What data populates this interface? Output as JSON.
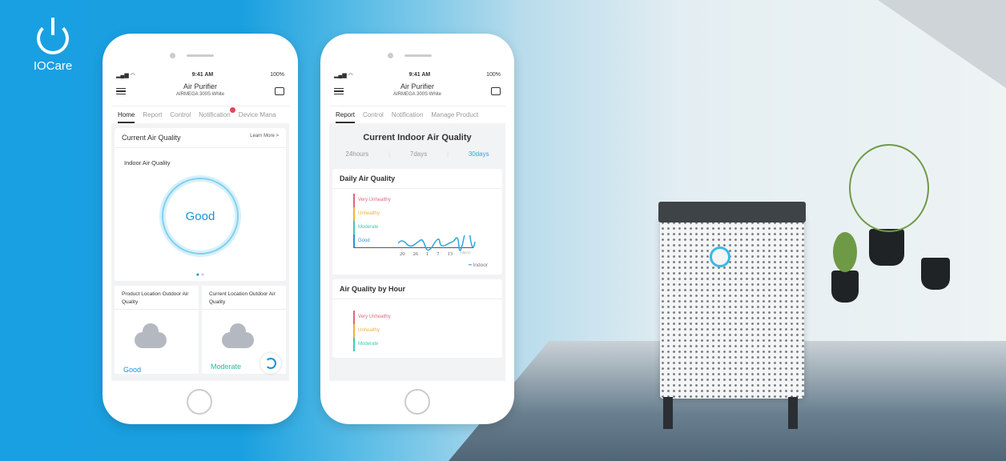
{
  "brand": {
    "logo_text": "IOCare"
  },
  "phone_home": {
    "status": {
      "time": "9:41 AM",
      "battery": "100%"
    },
    "header": {
      "title": "Air Purifier",
      "subtitle": "AIRMEGA 300S White"
    },
    "tabs": [
      {
        "label": "Home",
        "active": true
      },
      {
        "label": "Report"
      },
      {
        "label": "Control"
      },
      {
        "label": "Notification",
        "badge": true
      },
      {
        "label": "Device Mana"
      }
    ],
    "current_card": {
      "title": "Current Air Quality",
      "link": "Learn More >",
      "indoor_label": "Indoor Air Quality",
      "indoor_value": "Good"
    },
    "outdoor": [
      {
        "title": "Product Location Outdoor Air Quality",
        "value": "Good",
        "color": "#1893d6"
      },
      {
        "title": "Current Location Outdoor Air Quality",
        "value": "Moderate",
        "color": "#1fbfa0"
      }
    ]
  },
  "phone_report": {
    "status": {
      "time": "9:41 AM",
      "battery": "100%"
    },
    "header": {
      "title": "Air Purifier",
      "subtitle": "AIRMEGA 300S White"
    },
    "tabs": [
      {
        "label": "Report",
        "active": true
      },
      {
        "label": "Control"
      },
      {
        "label": "Notification"
      },
      {
        "label": "Manage Product"
      }
    ],
    "title": "Current Indoor Air Quality",
    "periods": [
      {
        "label": "24hours"
      },
      {
        "label": "7days"
      },
      {
        "label": "30days",
        "active": true
      }
    ],
    "daily": {
      "title": "Daily Air Quality",
      "levels": [
        {
          "label": "Very Unhealthy",
          "color": "#e0677c"
        },
        {
          "label": "Unhealthy",
          "color": "#f0b040"
        },
        {
          "label": "Moderate",
          "color": "#3ec9b0"
        },
        {
          "label": "Good",
          "color": "#2f8fd0"
        }
      ],
      "x_ticks": [
        "20",
        "26",
        "1",
        "7",
        "13"
      ],
      "x_unit": "(days)",
      "legend": "Indoor"
    },
    "hourly": {
      "title": "Air Quality by Hour",
      "levels": [
        {
          "label": "Very Unhealthy",
          "color": "#e0677c"
        },
        {
          "label": "Unhealthy",
          "color": "#f0b040"
        },
        {
          "label": "Moderate",
          "color": "#3ec9b0"
        }
      ]
    }
  }
}
